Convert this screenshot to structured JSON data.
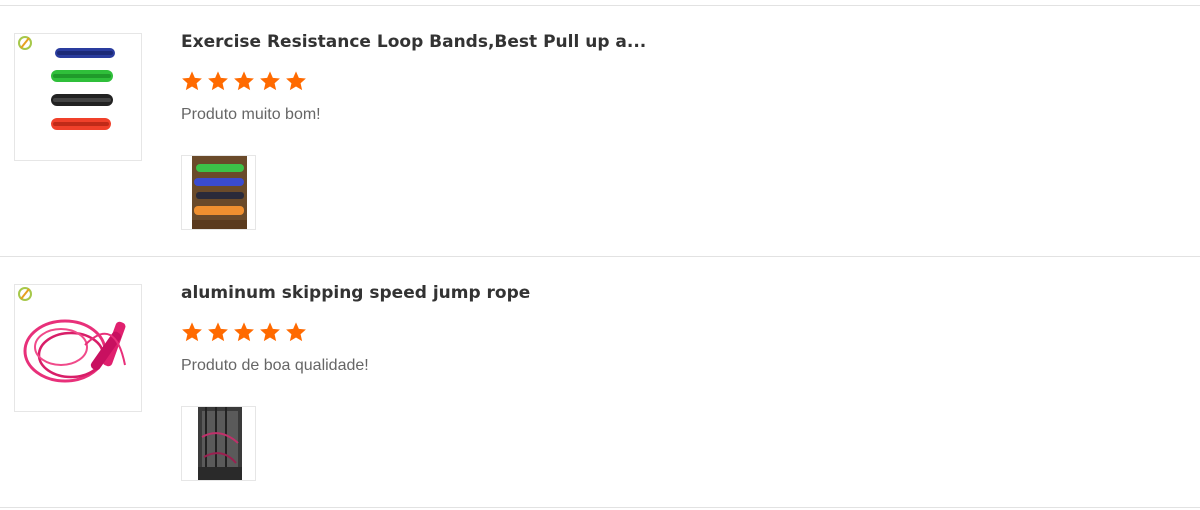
{
  "reviews": [
    {
      "product_title": "Exercise Resistance Loop Bands,Best Pull up a...",
      "rating": 5,
      "rating_max": 5,
      "comment": "Produto muito bom!",
      "product_image_icon": "resistance-bands-image",
      "photo_icon": "customer-photo-bands"
    },
    {
      "product_title": "aluminum skipping speed jump rope",
      "rating": 5,
      "rating_max": 5,
      "comment": "Produto de boa qualidade!",
      "product_image_icon": "jump-rope-image",
      "photo_icon": "customer-photo-rope"
    }
  ],
  "colors": {
    "star": "#ff6a00",
    "title": "#333333",
    "comment": "#666666",
    "divider": "#e2e2e2"
  }
}
